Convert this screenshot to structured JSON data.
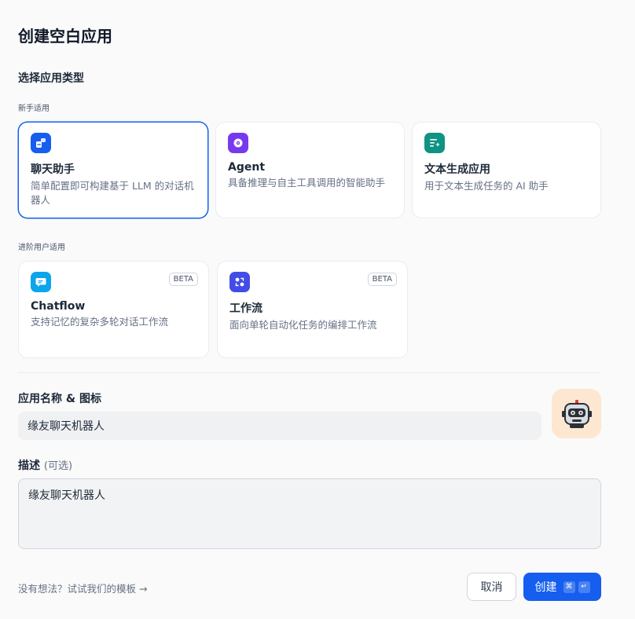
{
  "title": "创建空白应用",
  "section_title": "选择应用类型",
  "groups": {
    "beginner": "新手适用",
    "advanced": "进阶用户适用"
  },
  "cards": [
    {
      "name": "聊天助手",
      "desc": "简单配置即可构建基于 LLM 的对话机器人",
      "icon": "chat-bot-icon",
      "color": "#155eef",
      "selected": true
    },
    {
      "name": "Agent",
      "desc": "具备推理与自主工具调用的智能助手",
      "icon": "agent-icon",
      "color": "#7839ee",
      "selected": false
    },
    {
      "name": "文本生成应用",
      "desc": "用于文本生成任务的 AI 助手",
      "icon": "text-generation-icon",
      "color": "#0e9384",
      "selected": false
    },
    {
      "name": "Chatflow",
      "desc": "支持记忆的复杂多轮对话工作流",
      "icon": "chatflow-icon",
      "color": "#0ba5ec",
      "badge": "BETA",
      "selected": false
    },
    {
      "name": "工作流",
      "desc": "面向单轮自动化任务的编排工作流",
      "icon": "workflow-icon",
      "color": "#444ce7",
      "badge": "BETA",
      "selected": false
    }
  ],
  "name_field": {
    "label": "应用名称 & 图标",
    "value": "缘友聊天机器人"
  },
  "avatar": {
    "icon": "robot-icon",
    "background": "#fde7d0"
  },
  "description_field": {
    "label": "描述",
    "optional": "(可选)",
    "value": "缘友聊天机器人"
  },
  "template_link": "没有想法？试试我们的模板 →",
  "buttons": {
    "cancel": "取消",
    "create": "创建",
    "shortcut_cmd": "⌘",
    "shortcut_enter": "↵"
  }
}
